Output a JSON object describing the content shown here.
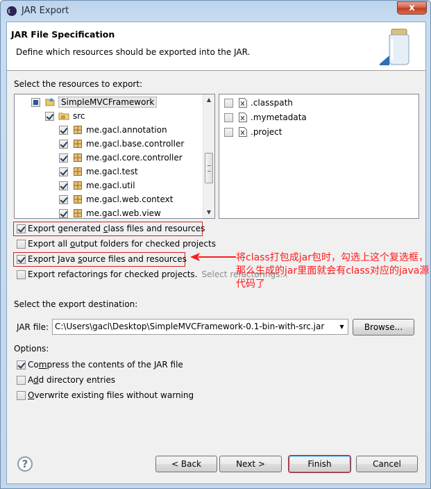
{
  "window": {
    "title": "JAR Export",
    "close_glyph": "x"
  },
  "header": {
    "title": "JAR File Specification",
    "description": "Define which resources should be exported into the JAR."
  },
  "resources": {
    "label": "Select the resources to export:",
    "tree": [
      {
        "label": "SimpleMVCFramework",
        "state": "partial",
        "icon": "project-icon"
      },
      {
        "label": "src",
        "state": "checked",
        "icon": "source-folder-icon"
      },
      {
        "label": "me.gacl.annotation",
        "state": "checked",
        "icon": "package-icon"
      },
      {
        "label": "me.gacl.base.controller",
        "state": "checked",
        "icon": "package-icon"
      },
      {
        "label": "me.gacl.core.controller",
        "state": "checked",
        "icon": "package-icon"
      },
      {
        "label": "me.gacl.test",
        "state": "checked",
        "icon": "package-icon"
      },
      {
        "label": "me.gacl.util",
        "state": "checked",
        "icon": "package-icon"
      },
      {
        "label": "me.gacl.web.context",
        "state": "checked",
        "icon": "package-icon"
      },
      {
        "label": "me.gacl.web.view",
        "state": "checked",
        "icon": "package-icon"
      }
    ],
    "files": [
      {
        "label": ".classpath",
        "state": "unchecked",
        "icon": "xml-file-icon"
      },
      {
        "label": ".mymetadata",
        "state": "unchecked",
        "icon": "xml-file-icon"
      },
      {
        "label": ".project",
        "state": "unchecked",
        "icon": "xml-file-icon"
      }
    ]
  },
  "export_options": {
    "class_files": {
      "pre": "Export generated ",
      "u": "c",
      "post": "lass files and resources",
      "checked": true
    },
    "output_folders": {
      "pre": "Export all ",
      "u": "o",
      "post": "utput folders for checked projects",
      "checked": false
    },
    "java_source": {
      "pre": "Export Java ",
      "u": "s",
      "post": "ource files and resources",
      "checked": true
    },
    "refactorings": {
      "pre": "Export refactorings for checked projects.",
      "checked": false
    },
    "select_refactorings_link": "Select refactorings..."
  },
  "annotation": {
    "text": "将class打包成jar包时，勾选上这个复选框，那么生成的jar里面就会有class对应的java源代码了",
    "color": "#ff1a1a"
  },
  "destination": {
    "label": "Select the export destination:",
    "jar_file_label": "JAR file:",
    "jar_file_value": "C:\\Users\\gacl\\Desktop\\SimpleMVCFramework-0.1-bin-with-src.jar",
    "browse_label": "Browse..."
  },
  "options": {
    "label": "Options:",
    "compress": {
      "pre": "Co",
      "u": "m",
      "post": "press the contents of the JAR file",
      "checked": true
    },
    "directory_entries": {
      "pre": "A",
      "u": "d",
      "post": "d directory entries",
      "checked": false
    },
    "overwrite": {
      "pre": "",
      "u": "O",
      "post": "verwrite existing files without warning",
      "checked": false
    }
  },
  "buttons": {
    "back": "< Back",
    "next": "Next >",
    "finish": "Finish",
    "cancel": "Cancel",
    "help_glyph": "?"
  }
}
